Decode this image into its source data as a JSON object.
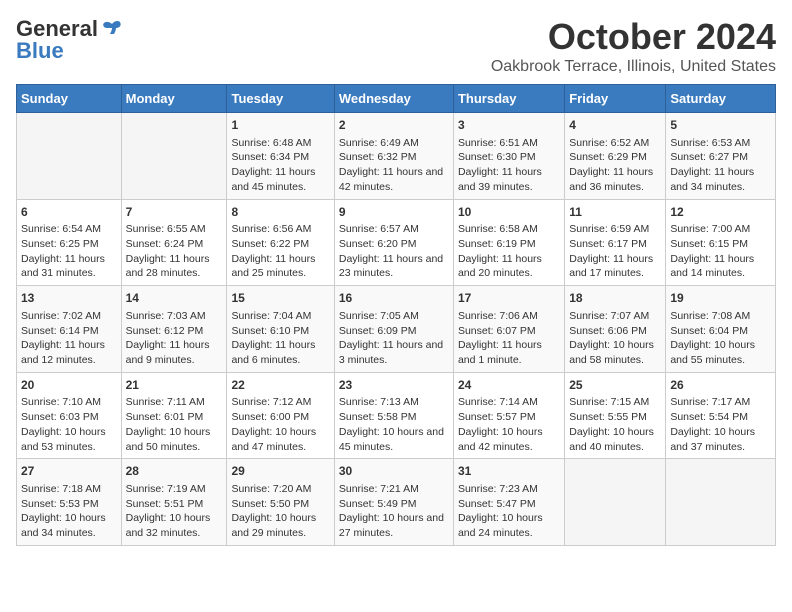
{
  "header": {
    "logo_general": "General",
    "logo_blue": "Blue",
    "month": "October 2024",
    "location": "Oakbrook Terrace, Illinois, United States"
  },
  "weekdays": [
    "Sunday",
    "Monday",
    "Tuesday",
    "Wednesday",
    "Thursday",
    "Friday",
    "Saturday"
  ],
  "weeks": [
    [
      {
        "day": "",
        "info": ""
      },
      {
        "day": "",
        "info": ""
      },
      {
        "day": "1",
        "info": "Sunrise: 6:48 AM\nSunset: 6:34 PM\nDaylight: 11 hours and 45 minutes."
      },
      {
        "day": "2",
        "info": "Sunrise: 6:49 AM\nSunset: 6:32 PM\nDaylight: 11 hours and 42 minutes."
      },
      {
        "day": "3",
        "info": "Sunrise: 6:51 AM\nSunset: 6:30 PM\nDaylight: 11 hours and 39 minutes."
      },
      {
        "day": "4",
        "info": "Sunrise: 6:52 AM\nSunset: 6:29 PM\nDaylight: 11 hours and 36 minutes."
      },
      {
        "day": "5",
        "info": "Sunrise: 6:53 AM\nSunset: 6:27 PM\nDaylight: 11 hours and 34 minutes."
      }
    ],
    [
      {
        "day": "6",
        "info": "Sunrise: 6:54 AM\nSunset: 6:25 PM\nDaylight: 11 hours and 31 minutes."
      },
      {
        "day": "7",
        "info": "Sunrise: 6:55 AM\nSunset: 6:24 PM\nDaylight: 11 hours and 28 minutes."
      },
      {
        "day": "8",
        "info": "Sunrise: 6:56 AM\nSunset: 6:22 PM\nDaylight: 11 hours and 25 minutes."
      },
      {
        "day": "9",
        "info": "Sunrise: 6:57 AM\nSunset: 6:20 PM\nDaylight: 11 hours and 23 minutes."
      },
      {
        "day": "10",
        "info": "Sunrise: 6:58 AM\nSunset: 6:19 PM\nDaylight: 11 hours and 20 minutes."
      },
      {
        "day": "11",
        "info": "Sunrise: 6:59 AM\nSunset: 6:17 PM\nDaylight: 11 hours and 17 minutes."
      },
      {
        "day": "12",
        "info": "Sunrise: 7:00 AM\nSunset: 6:15 PM\nDaylight: 11 hours and 14 minutes."
      }
    ],
    [
      {
        "day": "13",
        "info": "Sunrise: 7:02 AM\nSunset: 6:14 PM\nDaylight: 11 hours and 12 minutes."
      },
      {
        "day": "14",
        "info": "Sunrise: 7:03 AM\nSunset: 6:12 PM\nDaylight: 11 hours and 9 minutes."
      },
      {
        "day": "15",
        "info": "Sunrise: 7:04 AM\nSunset: 6:10 PM\nDaylight: 11 hours and 6 minutes."
      },
      {
        "day": "16",
        "info": "Sunrise: 7:05 AM\nSunset: 6:09 PM\nDaylight: 11 hours and 3 minutes."
      },
      {
        "day": "17",
        "info": "Sunrise: 7:06 AM\nSunset: 6:07 PM\nDaylight: 11 hours and 1 minute."
      },
      {
        "day": "18",
        "info": "Sunrise: 7:07 AM\nSunset: 6:06 PM\nDaylight: 10 hours and 58 minutes."
      },
      {
        "day": "19",
        "info": "Sunrise: 7:08 AM\nSunset: 6:04 PM\nDaylight: 10 hours and 55 minutes."
      }
    ],
    [
      {
        "day": "20",
        "info": "Sunrise: 7:10 AM\nSunset: 6:03 PM\nDaylight: 10 hours and 53 minutes."
      },
      {
        "day": "21",
        "info": "Sunrise: 7:11 AM\nSunset: 6:01 PM\nDaylight: 10 hours and 50 minutes."
      },
      {
        "day": "22",
        "info": "Sunrise: 7:12 AM\nSunset: 6:00 PM\nDaylight: 10 hours and 47 minutes."
      },
      {
        "day": "23",
        "info": "Sunrise: 7:13 AM\nSunset: 5:58 PM\nDaylight: 10 hours and 45 minutes."
      },
      {
        "day": "24",
        "info": "Sunrise: 7:14 AM\nSunset: 5:57 PM\nDaylight: 10 hours and 42 minutes."
      },
      {
        "day": "25",
        "info": "Sunrise: 7:15 AM\nSunset: 5:55 PM\nDaylight: 10 hours and 40 minutes."
      },
      {
        "day": "26",
        "info": "Sunrise: 7:17 AM\nSunset: 5:54 PM\nDaylight: 10 hours and 37 minutes."
      }
    ],
    [
      {
        "day": "27",
        "info": "Sunrise: 7:18 AM\nSunset: 5:53 PM\nDaylight: 10 hours and 34 minutes."
      },
      {
        "day": "28",
        "info": "Sunrise: 7:19 AM\nSunset: 5:51 PM\nDaylight: 10 hours and 32 minutes."
      },
      {
        "day": "29",
        "info": "Sunrise: 7:20 AM\nSunset: 5:50 PM\nDaylight: 10 hours and 29 minutes."
      },
      {
        "day": "30",
        "info": "Sunrise: 7:21 AM\nSunset: 5:49 PM\nDaylight: 10 hours and 27 minutes."
      },
      {
        "day": "31",
        "info": "Sunrise: 7:23 AM\nSunset: 5:47 PM\nDaylight: 10 hours and 24 minutes."
      },
      {
        "day": "",
        "info": ""
      },
      {
        "day": "",
        "info": ""
      }
    ]
  ]
}
